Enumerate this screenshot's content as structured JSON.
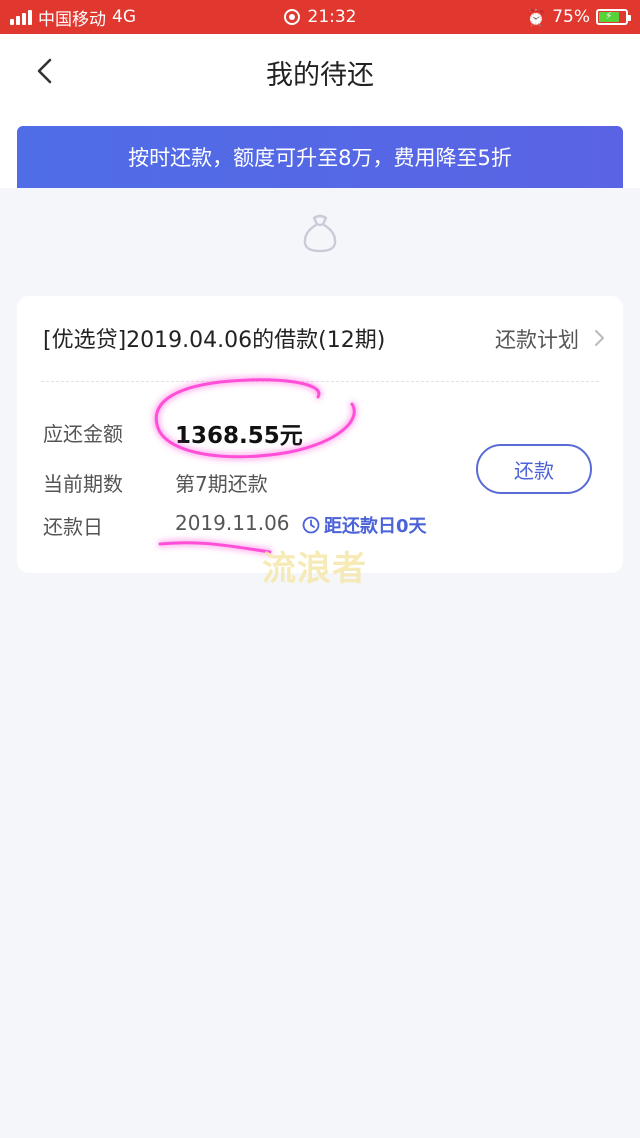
{
  "status_bar": {
    "carrier": "中国移动",
    "network": "4G",
    "time": "21:32",
    "battery": "75%"
  },
  "nav": {
    "title": "我的待还"
  },
  "banner": {
    "text": "按时还款，额度可升至8万，费用降至5折"
  },
  "loan_card": {
    "title": "[优选贷]2019.04.06的借款(12期)",
    "plan_link": "还款计划",
    "amount_label": "应还金额",
    "amount_value": "1368.55元",
    "period_label": "当前期数",
    "period_value": "第7期还款",
    "date_label": "还款日",
    "date_value": "2019.11.06",
    "countdown": "距还款日0天",
    "repay_button": "还款"
  },
  "watermark": "流浪者",
  "colors": {
    "status_bar": "#e0372e",
    "accent": "#4c62d8",
    "banner": "#5a63e4",
    "ink": "#ff4fd8"
  }
}
